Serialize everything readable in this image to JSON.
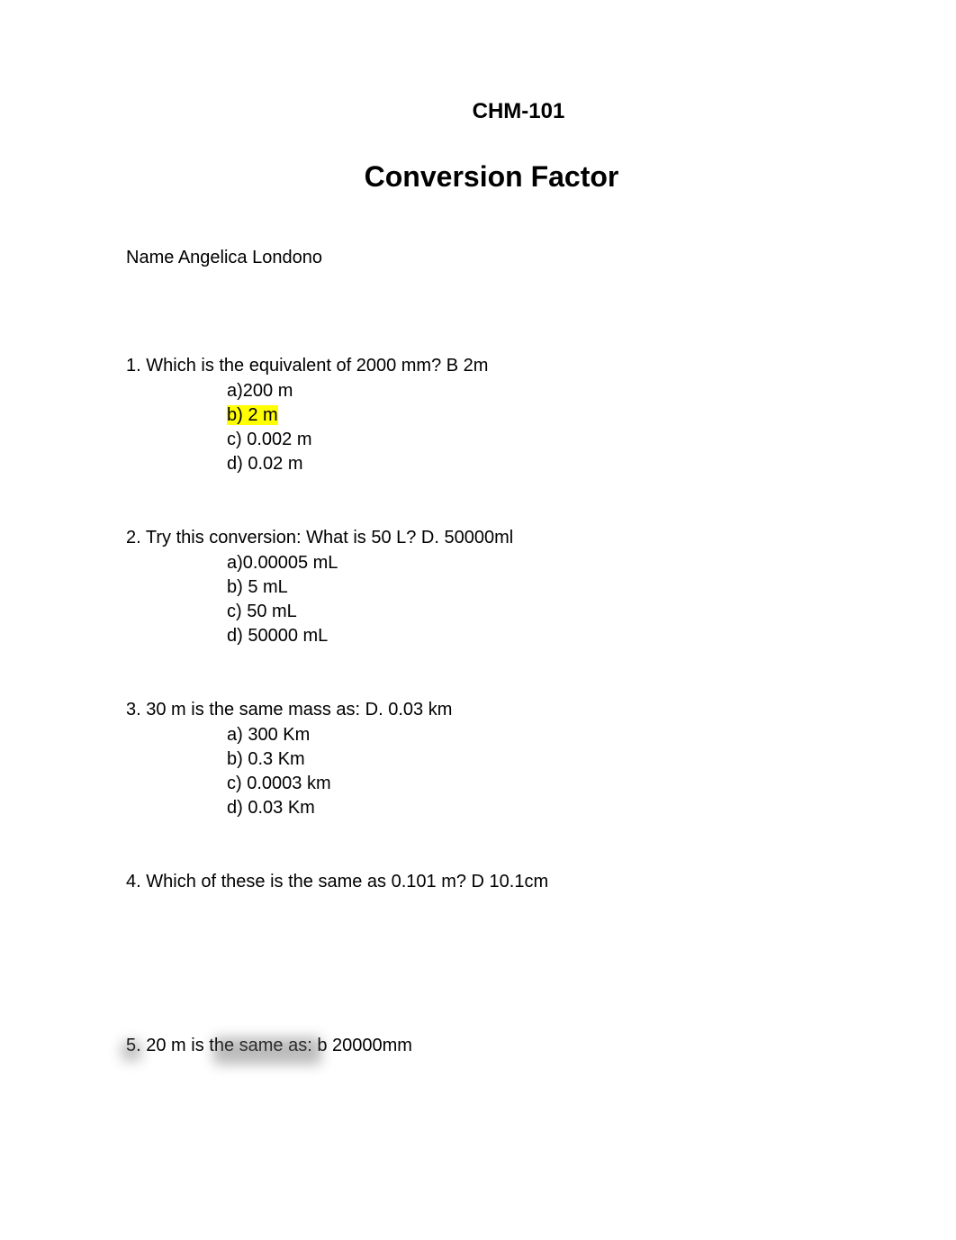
{
  "course_code": "CHM-101",
  "title": "Conversion Factor",
  "name_label": "Name",
  "student_name": "Angelica Londono",
  "questions": [
    {
      "number": "1.",
      "text": "Which is the equivalent of 2000 mm? B 2m",
      "options": [
        {
          "label": "a)200 m",
          "highlighted": false
        },
        {
          "label": "b) 2 m",
          "highlighted": true
        },
        {
          "label": "c) 0.002 m",
          "highlighted": false
        },
        {
          "label": "d) 0.02 m",
          "highlighted": false
        }
      ]
    },
    {
      "number": "2.",
      "text": "Try this conversion: What is 50 L? D. 50000ml",
      "options": [
        {
          "label": "a)0.00005 mL",
          "highlighted": false
        },
        {
          "label": "b) 5 mL",
          "highlighted": false
        },
        {
          "label": "c) 50 mL",
          "highlighted": false
        },
        {
          "label": "d) 50000 mL",
          "highlighted": false
        }
      ]
    },
    {
      "number": "3.",
      "text": "30 m is the same mass as: D. 0.03 km",
      "options": [
        {
          "label": "a) 300 Km",
          "highlighted": false
        },
        {
          "label": "b) 0.3 Km",
          "highlighted": false
        },
        {
          "label": "c) 0.0003 km",
          "highlighted": false
        },
        {
          "label": "d) 0.03 Km",
          "highlighted": false
        }
      ]
    },
    {
      "number": "4.",
      "text": "Which of these is the same as 0.101 m? D 10.1cm",
      "options": []
    },
    {
      "number": "5.",
      "text": "20 m is the same as: b 20000mm",
      "options": []
    }
  ]
}
